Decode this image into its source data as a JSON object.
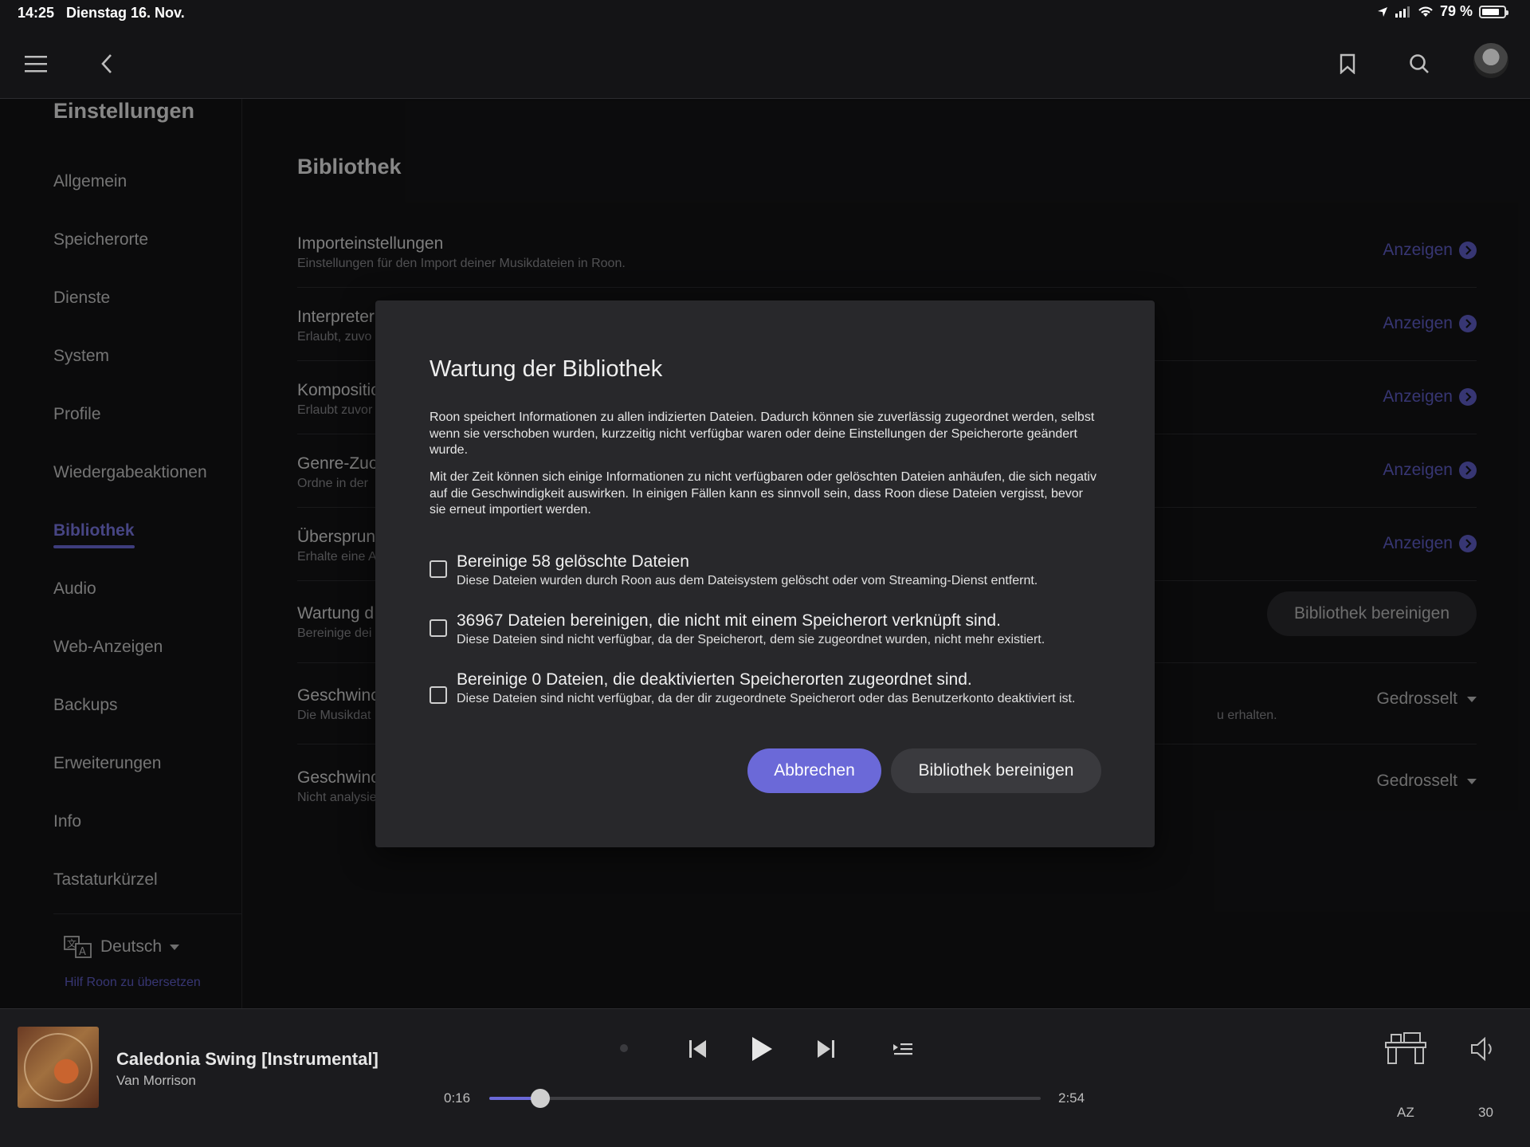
{
  "status": {
    "time": "14:25",
    "date": "Dienstag 16. Nov.",
    "battery": "79 %",
    "battery_level": 0.79
  },
  "topbar": {
    "menu_icon": "menu-icon",
    "back_icon": "back-icon",
    "bookmark_icon": "bookmark-icon",
    "search_icon": "search-icon",
    "avatar_icon": "avatar"
  },
  "sidebar": {
    "title": "Einstellungen",
    "items": [
      {
        "label": "Allgemein"
      },
      {
        "label": "Speicherorte"
      },
      {
        "label": "Dienste"
      },
      {
        "label": "System"
      },
      {
        "label": "Profile"
      },
      {
        "label": "Wiedergabeaktionen"
      },
      {
        "label": "Bibliothek",
        "active": true
      },
      {
        "label": "Audio"
      },
      {
        "label": "Web-Anzeigen"
      },
      {
        "label": "Backups"
      },
      {
        "label": "Erweiterungen"
      },
      {
        "label": "Info"
      },
      {
        "label": "Tastaturkürzel"
      }
    ],
    "language": "Deutsch",
    "help_link": "Hilf Roon zu übersetzen"
  },
  "main": {
    "section_title": "Bibliothek",
    "rows": [
      {
        "title": "Importeinstellungen",
        "subtitle": "Einstellungen für den Import deiner Musikdateien in Roon.",
        "action": "Anzeigen"
      },
      {
        "title": "Interpreter",
        "subtitle": "Erlaubt, zuvo",
        "action": "Anzeigen"
      },
      {
        "title": "Kompositio",
        "subtitle": "Erlaubt zuvor",
        "action": "Anzeigen"
      },
      {
        "title": "Genre-Zuo",
        "subtitle": "Ordne in der",
        "action": "Anzeigen"
      },
      {
        "title": "Übersprun",
        "subtitle": "Erhalte eine A",
        "action": "Anzeigen"
      },
      {
        "title": "Wartung d",
        "subtitle": "Bereinige dei",
        "button": "Bibliothek bereinigen"
      },
      {
        "title": "Geschwinc",
        "subtitle": "Die Musikdat",
        "subtitle_tail": "u erhalten.",
        "dropdown": "Gedrosselt"
      },
      {
        "title": "Geschwinc",
        "subtitle": "Nicht analysie",
        "dropdown": "Gedrosselt"
      }
    ]
  },
  "modal": {
    "title": "Wartung der Bibliothek",
    "para1": "Roon speichert Informationen zu allen indizierten Dateien. Dadurch können sie zuverlässig zugeordnet werden, selbst wenn sie verschoben wurden, kurzzeitig nicht verfügbar waren oder deine Einstellungen der Speicherorte geändert wurde.",
    "para2": "Mit der Zeit können sich einige Informationen zu nicht verfügbaren oder gelöschten Dateien anhäufen, die sich negativ auf die Geschwindigkeit auswirken. In einigen Fällen kann es sinnvoll sein, dass Roon diese Dateien vergisst, bevor sie erneut importiert werden.",
    "options": [
      {
        "title": "Bereinige 58 gelöschte Dateien",
        "subtitle": "Diese Dateien wurden durch Roon aus dem Dateisystem gelöscht oder vom Streaming-Dienst entfernt.",
        "checked": false
      },
      {
        "title": "36967 Dateien bereinigen, die nicht mit einem Speicherort verknüpft sind.",
        "subtitle": "Diese Dateien sind nicht verfügbar, da der Speicherort, dem sie zugeordnet wurden, nicht mehr existiert.",
        "checked": false
      },
      {
        "title": "Bereinige 0 Dateien, die deaktivierten Speicherorten zugeordnet sind.",
        "subtitle": "Diese Dateien sind nicht verfügbar, da der dir zugeordnete Speicherort oder das Benutzerkonto deaktiviert ist.",
        "checked": false
      }
    ],
    "cancel_label": "Abbrechen",
    "confirm_label": "Bibliothek bereinigen"
  },
  "player": {
    "track": "Caledonia Swing [Instrumental]",
    "artist": "Van Morrison",
    "elapsed": "0:16",
    "duration": "2:54",
    "progress": 0.092,
    "zone": "AZ",
    "volume": "30",
    "accent": "#6b69d8"
  }
}
